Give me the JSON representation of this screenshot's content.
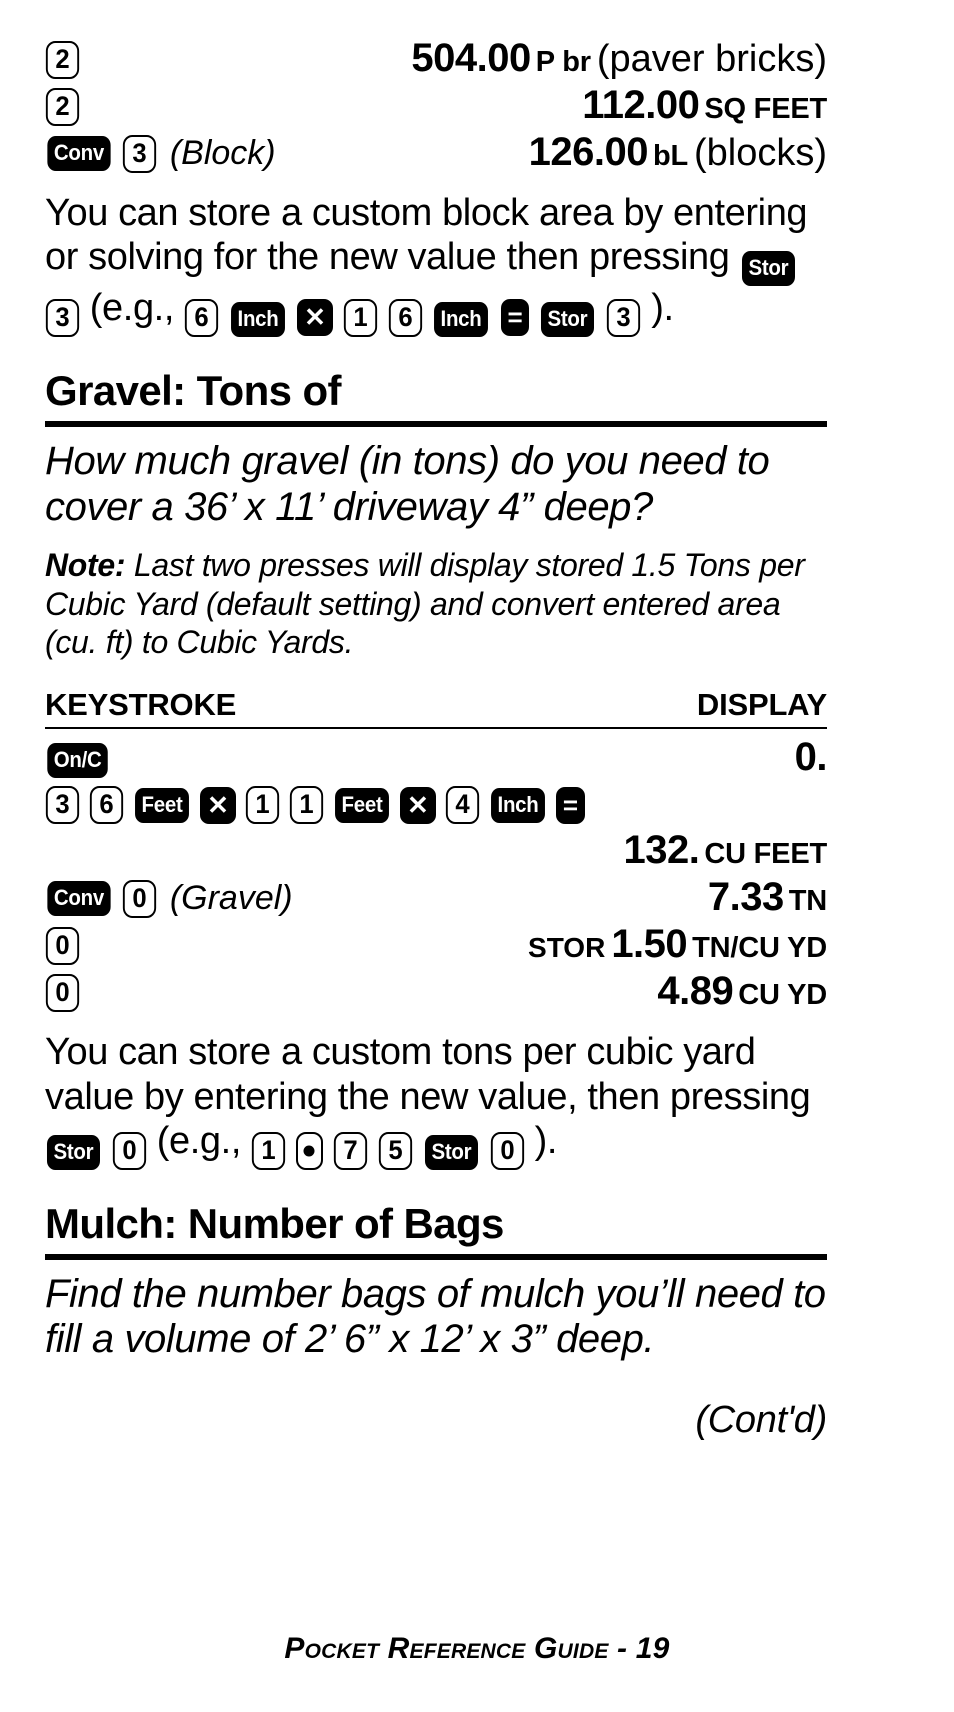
{
  "page": {
    "footer": "Pocket Reference Guide - 19",
    "cont_label": "(Cont'd)"
  },
  "top_table": {
    "rows": [
      {
        "keys": [
          {
            "type": "num",
            "label": "2"
          }
        ],
        "annotation": "",
        "prefix": "",
        "value": "504.00",
        "unit": "P br",
        "unit_note": "(paver bricks)"
      },
      {
        "keys": [
          {
            "type": "num",
            "label": "2"
          }
        ],
        "annotation": "",
        "prefix": "",
        "value": "112.00",
        "unit": "SQ FEET",
        "unit_note": ""
      },
      {
        "keys": [
          {
            "type": "fn",
            "label": "Conv"
          },
          {
            "type": "num",
            "label": "3"
          }
        ],
        "annotation": "(Block)",
        "prefix": "",
        "value": "126.00",
        "unit": "bL",
        "unit_note": "(blocks)"
      }
    ]
  },
  "block_para": {
    "part1": "You can store a custom block area by entering or solving for the new value then pressing ",
    "keys_a": [
      {
        "type": "fn",
        "label": "Stor"
      },
      {
        "type": "num",
        "label": "3"
      }
    ],
    "part2": " (e.g., ",
    "keys_b": [
      {
        "type": "num",
        "label": "6"
      },
      {
        "type": "fn",
        "label": "Inch"
      },
      {
        "type": "sym",
        "label": "✕"
      },
      {
        "type": "num",
        "label": "1"
      },
      {
        "type": "num",
        "label": "6"
      },
      {
        "type": "fn",
        "label": "Inch"
      },
      {
        "type": "sym",
        "label": "="
      },
      {
        "type": "fn",
        "label": "Stor"
      },
      {
        "type": "num",
        "label": "3"
      }
    ],
    "part3": ")."
  },
  "gravel": {
    "heading": "Gravel: Tons of",
    "question": "How much gravel (in tons) do you need to cover a 36’ x 11’ driveway 4” deep?",
    "note_label": "Note:",
    "note_text": "Last two presses will display stored 1.5 Tons per Cubic Yard (default setting) and convert entered area (cu. ft) to Cubic Yards.",
    "table": {
      "col_keystroke": "KEYSTROKE",
      "col_display": "DISPLAY",
      "rows": [
        {
          "keys": [
            {
              "type": "fn",
              "label": "On/C"
            }
          ],
          "annotation": "",
          "prefix": "",
          "value": "0.",
          "unit": "",
          "unit_note": ""
        },
        {
          "keys": [
            {
              "type": "num",
              "label": "3"
            },
            {
              "type": "num",
              "label": "6"
            },
            {
              "type": "fn",
              "label": "Feet"
            },
            {
              "type": "sym",
              "label": "✕"
            },
            {
              "type": "num",
              "label": "1"
            },
            {
              "type": "num",
              "label": "1"
            },
            {
              "type": "fn",
              "label": "Feet"
            },
            {
              "type": "sym",
              "label": "✕"
            },
            {
              "type": "num",
              "label": "4"
            },
            {
              "type": "fn",
              "label": "Inch"
            },
            {
              "type": "sym",
              "label": "="
            }
          ],
          "annotation": "",
          "prefix": "",
          "value": "",
          "unit": "",
          "unit_note": ""
        },
        {
          "keys": [],
          "annotation": "",
          "prefix": "",
          "value": "132.",
          "unit": "CU FEET",
          "unit_note": ""
        },
        {
          "keys": [
            {
              "type": "fn",
              "label": "Conv"
            },
            {
              "type": "num",
              "label": "0"
            }
          ],
          "annotation": "(Gravel)",
          "prefix": "",
          "value": "7.33",
          "unit": "TN",
          "unit_note": ""
        },
        {
          "keys": [
            {
              "type": "num",
              "label": "0"
            }
          ],
          "annotation": "",
          "prefix": "STOR",
          "value": "1.50",
          "unit": "TN/CU YD",
          "unit_note": ""
        },
        {
          "keys": [
            {
              "type": "num",
              "label": "0"
            }
          ],
          "annotation": "",
          "prefix": "",
          "value": "4.89",
          "unit": "CU YD",
          "unit_note": ""
        }
      ]
    },
    "para": {
      "part1": "You can store a custom tons per cubic yard value by entering the new value, then pressing ",
      "keys_a": [
        {
          "type": "fn",
          "label": "Stor"
        },
        {
          "type": "num",
          "label": "0"
        }
      ],
      "part2": " (e.g., ",
      "keys_b": [
        {
          "type": "num",
          "label": "1"
        },
        {
          "type": "dot",
          "label": "."
        },
        {
          "type": "num",
          "label": "7"
        },
        {
          "type": "num",
          "label": "5"
        },
        {
          "type": "fn",
          "label": "Stor"
        },
        {
          "type": "num",
          "label": "0"
        }
      ],
      "part3": ")."
    }
  },
  "mulch": {
    "heading": "Mulch: Number of Bags",
    "question": "Find the number bags of mulch you’ll need to fill a volume of 2’ 6” x 12’ x 3” deep."
  }
}
